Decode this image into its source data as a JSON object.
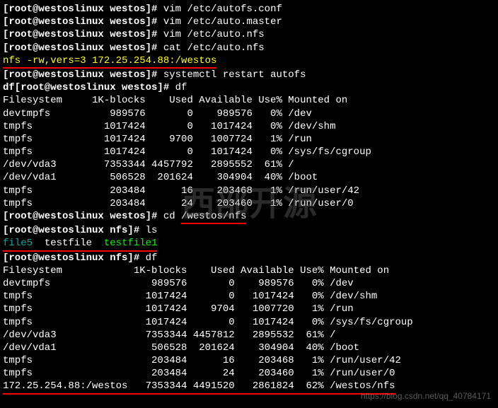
{
  "prompt1": "[root@westoslinux westos]# ",
  "prompt2": "[root@westoslinux nfs]# ",
  "prompt_df": "df[root@westoslinux westos]# ",
  "cmds": {
    "c1": "vim /etc/autofs.conf",
    "c2": "vim /etc/auto.master",
    "c3": "vim /etc/auto.nfs",
    "c4": "cat /etc/auto.nfs",
    "c5": "systemctl restart autofs",
    "c6": "df",
    "c7_pre": "cd ",
    "c7_arg": "/westos/nfs",
    "c8": "ls",
    "c9": "df"
  },
  "nfs_line_pre": "nfs -rw,vers=3 ",
  "nfs_line_ip": "172.25.254.88:/westos",
  "df1": {
    "header": "Filesystem     1K-blocks    Used Available Use% Mounted on",
    "rows": [
      "devtmpfs          989576       0    989576   0% /dev",
      "tmpfs            1017424       0   1017424   0% /dev/shm",
      "tmpfs            1017424    9700   1007724   1% /run",
      "tmpfs            1017424       0   1017424   0% /sys/fs/cgroup",
      "/dev/vda3        7353344 4457792   2895552  61% /",
      "/dev/vda1         506528  201624    304904  40% /boot",
      "tmpfs             203484      16    203468   1% /run/user/42",
      "tmpfs             203484      24    203460   1% /run/user/0"
    ]
  },
  "ls_output": {
    "f1": "file5",
    "f2": "testfile",
    "f3": "testfile1"
  },
  "df2": {
    "header": "Filesystem            1K-blocks    Used Available Use% Mounted on",
    "rows": [
      "devtmpfs                 989576       0    989576   0% /dev",
      "tmpfs                   1017424       0   1017424   0% /dev/shm",
      "tmpfs                   1017424    9704   1007720   1% /run",
      "tmpfs                   1017424       0   1017424   0% /sys/fs/cgroup",
      "/dev/vda3               7353344 4457812   2895532  61% /",
      "/dev/vda1                506528  201624    304904  40% /boot",
      "tmpfs                    203484      16    203468   1% /run/user/42",
      "tmpfs                    203484      24    203460   1% /run/user/0"
    ],
    "last": "172.25.254.88:/westos   7353344 4491520   2861824  62% /westos/nfs"
  },
  "watermark": "西部开源",
  "watermark_small": "https://blog.csdn.net/qq_40784171"
}
